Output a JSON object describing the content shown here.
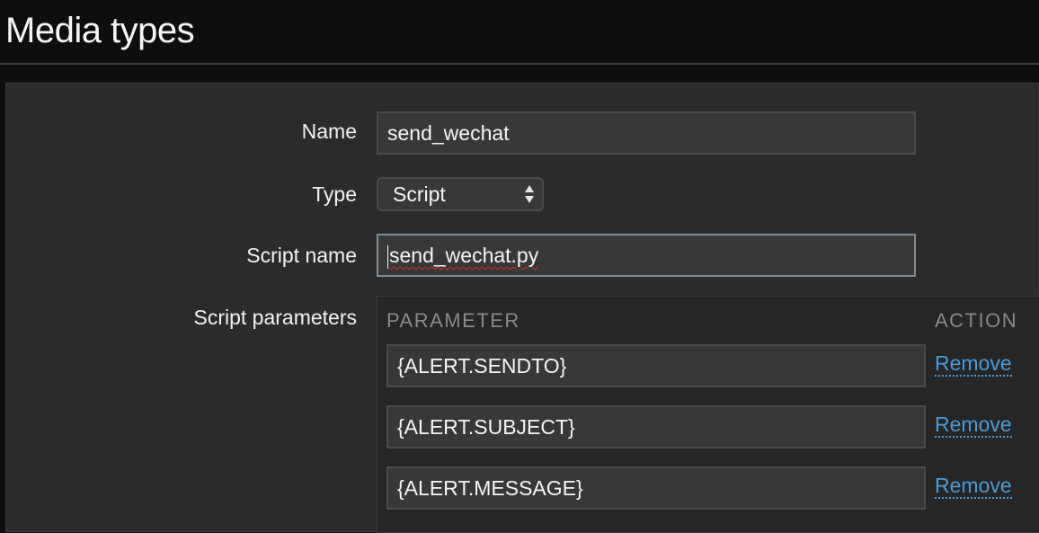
{
  "header": {
    "title": "Media types"
  },
  "form": {
    "name_label": "Name",
    "name_value": "send_wechat",
    "type_label": "Type",
    "type_value": "Script",
    "script_name_label": "Script name",
    "script_name_value": "send_wechat.py",
    "script_params_label": "Script parameters"
  },
  "params": {
    "col_parameter": "PARAMETER",
    "col_action": "ACTION",
    "rows": [
      {
        "value": "{ALERT.SENDTO}",
        "action": "Remove"
      },
      {
        "value": "{ALERT.SUBJECT}",
        "action": "Remove"
      },
      {
        "value": "{ALERT.MESSAGE}",
        "action": "Remove"
      }
    ]
  },
  "colors": {
    "link": "#4a9ad8",
    "panel": "#2b2b2b",
    "header_bg": "#0e0e0e"
  },
  "icons": {
    "select_arrows": "updown-arrows-icon"
  }
}
